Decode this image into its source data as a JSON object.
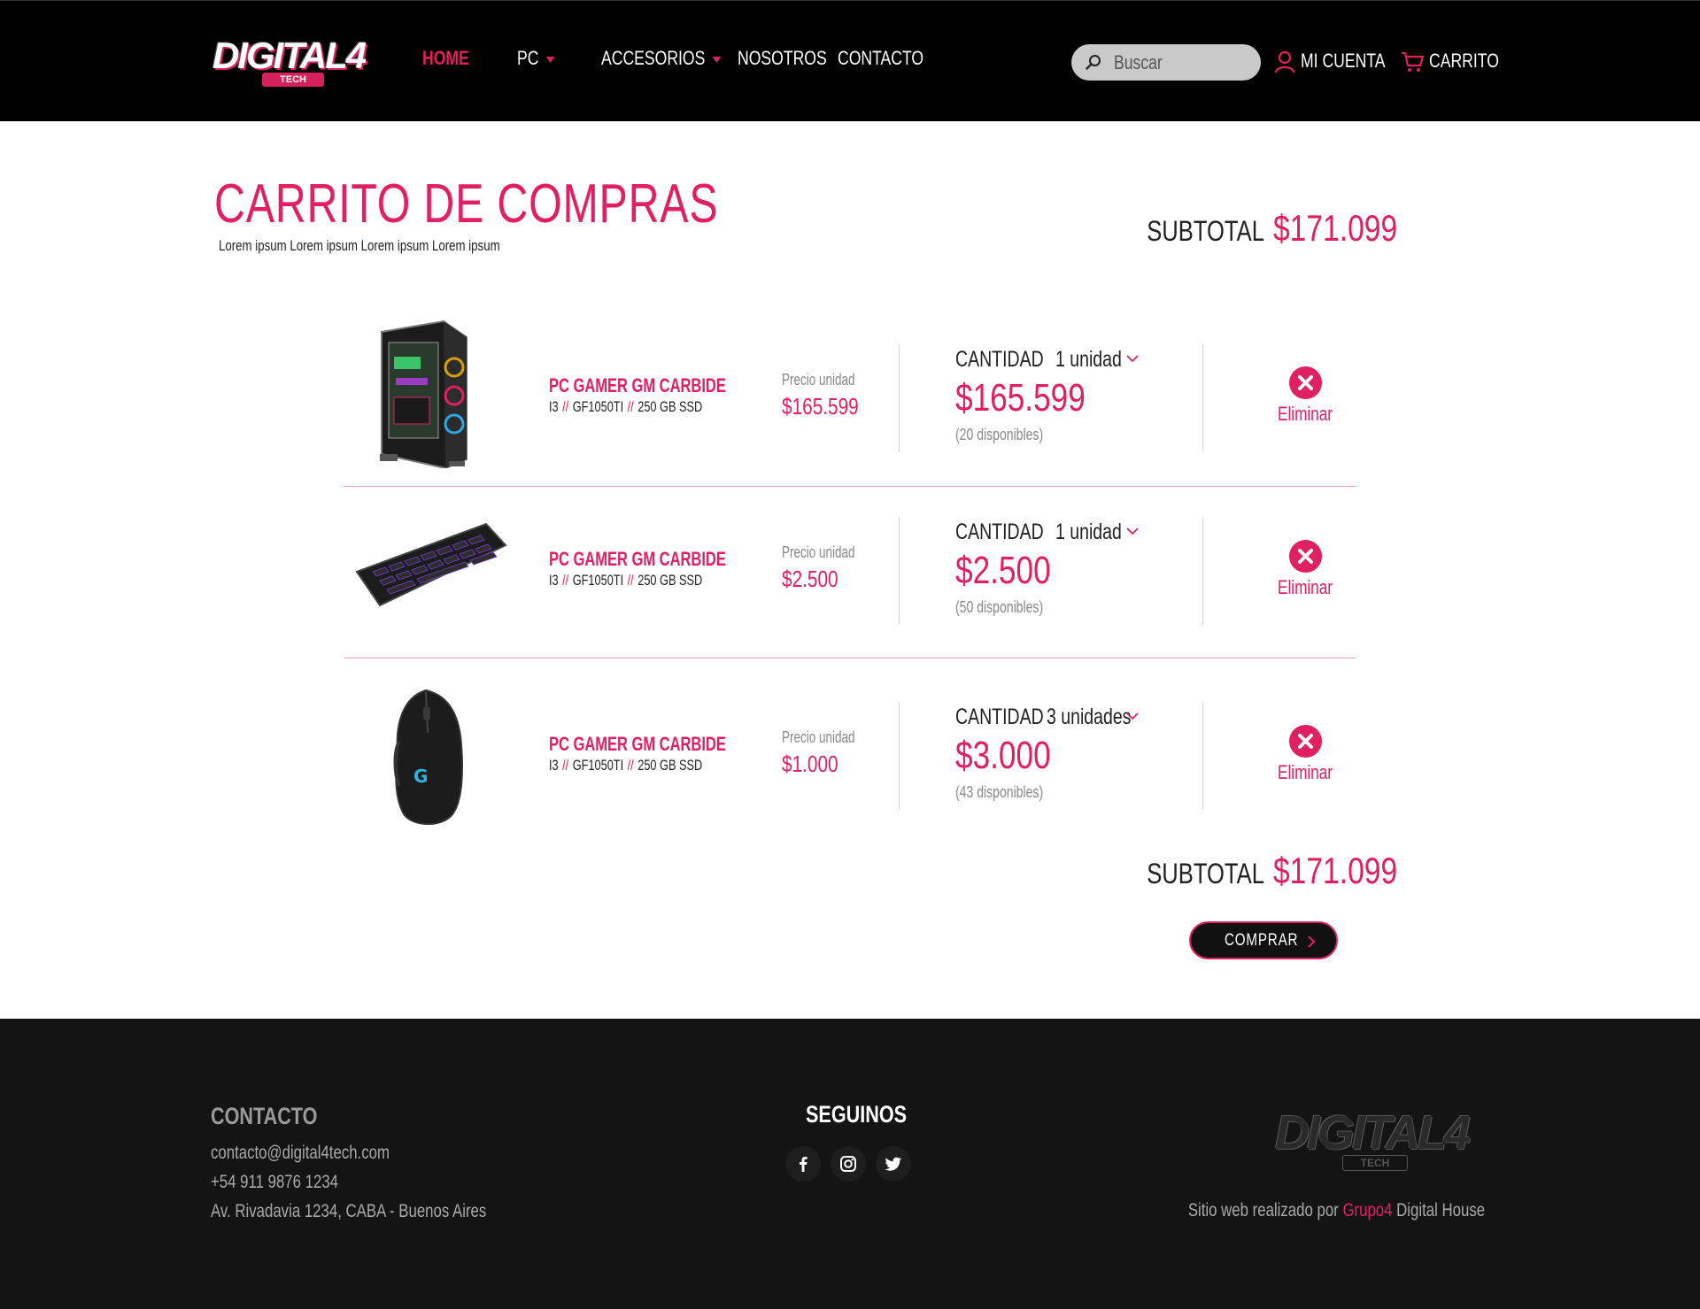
{
  "header": {
    "logo_text": "DIGITAL4",
    "logo_tag": "TECH",
    "nav": [
      {
        "label": "HOME"
      },
      {
        "label": "PC"
      },
      {
        "label": "ACCESORIOS"
      },
      {
        "label": "NOSOTROS"
      },
      {
        "label": "CONTACTO"
      }
    ],
    "search_placeholder": "Buscar",
    "account_label": "MI CUENTA",
    "cart_label": "CARRITO"
  },
  "cart": {
    "title": "CARRITO DE COMPRAS",
    "subtitle": "Lorem ipsum Lorem ipsum Lorem ipsum Lorem ipsum",
    "subtotal_label": "SUBTOTAL",
    "subtotal_value": "$171.099",
    "unit_price_label": "Precio unidad",
    "quantity_label": "CANTIDAD",
    "delete_label": "Eliminar",
    "items": [
      {
        "name": "PC GAMER GM CARBIDE",
        "spec_1": "I3",
        "spec_sep": "//",
        "spec_2": "GF1050TI",
        "spec_3": "250 GB SSD",
        "unit_price": "$165.599",
        "quantity": "1 unidad",
        "total": "$165.599",
        "available": "(20 disponibles)",
        "image": "pc-case-image"
      },
      {
        "name": "PC GAMER GM CARBIDE",
        "spec_1": "I3",
        "spec_sep": "//",
        "spec_2": "GF1050TI",
        "spec_3": "250 GB SSD",
        "unit_price": "$2.500",
        "quantity": "1 unidad",
        "total": "$2.500",
        "available": "(50 disponibles)",
        "image": "keyboard-image"
      },
      {
        "name": "PC GAMER GM CARBIDE",
        "spec_1": "I3",
        "spec_sep": "//",
        "spec_2": "GF1050TI",
        "spec_3": "250 GB SSD",
        "unit_price": "$1.000",
        "quantity": "3 unidades",
        "total": "$3.000",
        "available": "(43 disponibles)",
        "image": "mouse-image"
      }
    ],
    "buy_label": "COMPRAR"
  },
  "footer": {
    "contact_title": "CONTACTO",
    "email": "contacto@digital4tech.com",
    "phone": "+54 911 9876 1234",
    "address": "Av. Rivadavia 1234, CABA -  Buenos Aires",
    "follow_title": "SEGUINOS",
    "social": [
      "facebook-icon",
      "instagram-icon",
      "twitter-icon"
    ],
    "logo_text": "DIGITAL4",
    "logo_tag": "TECH",
    "credits_prefix": "Sitio web realizado por",
    "credits_group": "Grupo4",
    "credits_suffix": "Digital House"
  },
  "colors": {
    "accent": "#e02060",
    "header_bg": "#000000",
    "footer_bg": "#141414"
  }
}
